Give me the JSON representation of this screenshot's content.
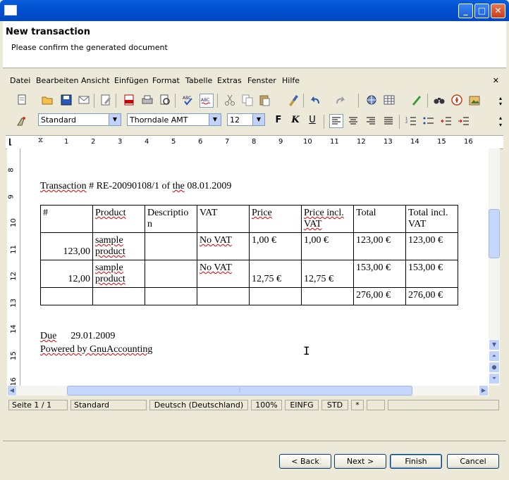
{
  "window": {
    "title": ""
  },
  "header": {
    "title": "New transaction",
    "subtitle": "Please confirm the generated document"
  },
  "menu": {
    "items": [
      "Datei",
      "Bearbeiten",
      "Ansicht",
      "Einfügen",
      "Format",
      "Tabelle",
      "Extras",
      "Fenster",
      "Hilfe"
    ],
    "close": "✕"
  },
  "format_toolbar": {
    "style": "Standard",
    "font": "Thorndale AMT",
    "size": "12",
    "bold": "F",
    "italic": "K",
    "underline": "U"
  },
  "ruler": {
    "h_numbers": [
      "1",
      "2",
      "3",
      "4",
      "5",
      "6",
      "7",
      "8",
      "9",
      "10",
      "11",
      "12",
      "13",
      "14",
      "15",
      "16"
    ],
    "v_numbers": [
      "8",
      "9",
      "10",
      "11",
      "12",
      "13",
      "14",
      "15",
      "16"
    ]
  },
  "document": {
    "heading_parts": [
      "Transaction",
      " # RE-20090108/1 of ",
      "the",
      " 08.01.2009"
    ],
    "table": {
      "headers": [
        "#",
        "Product",
        "Descriptio n",
        "VAT",
        "Price",
        "Price incl. VAT",
        "Total",
        "Total incl. VAT"
      ],
      "rows": [
        [
          "123,00",
          "sample product",
          "",
          "No VAT",
          "1,00 €",
          "1,00 €",
          "123,00 €",
          "123,00 €"
        ],
        [
          "12,00",
          "sample product",
          "",
          "No VAT",
          "12,75 €",
          "12,75 €",
          "153,00 €",
          "153,00 €"
        ],
        [
          "",
          "",
          "",
          "",
          "",
          "",
          "276,00 €",
          "276,00 €"
        ]
      ]
    },
    "due_label": "Due",
    "due_date": "29.01.2009",
    "powered": "Powered by GnuAccounting"
  },
  "statusbar": {
    "page": "Seite 1 / 1",
    "style": "Standard",
    "language": "Deutsch (Deutschland)",
    "zoom": "100%",
    "insert": "EINFG",
    "select": "STD",
    "modified": "*"
  },
  "buttons": {
    "back": "< Back",
    "next": "Next >",
    "finish": "Finish",
    "cancel": "Cancel"
  }
}
